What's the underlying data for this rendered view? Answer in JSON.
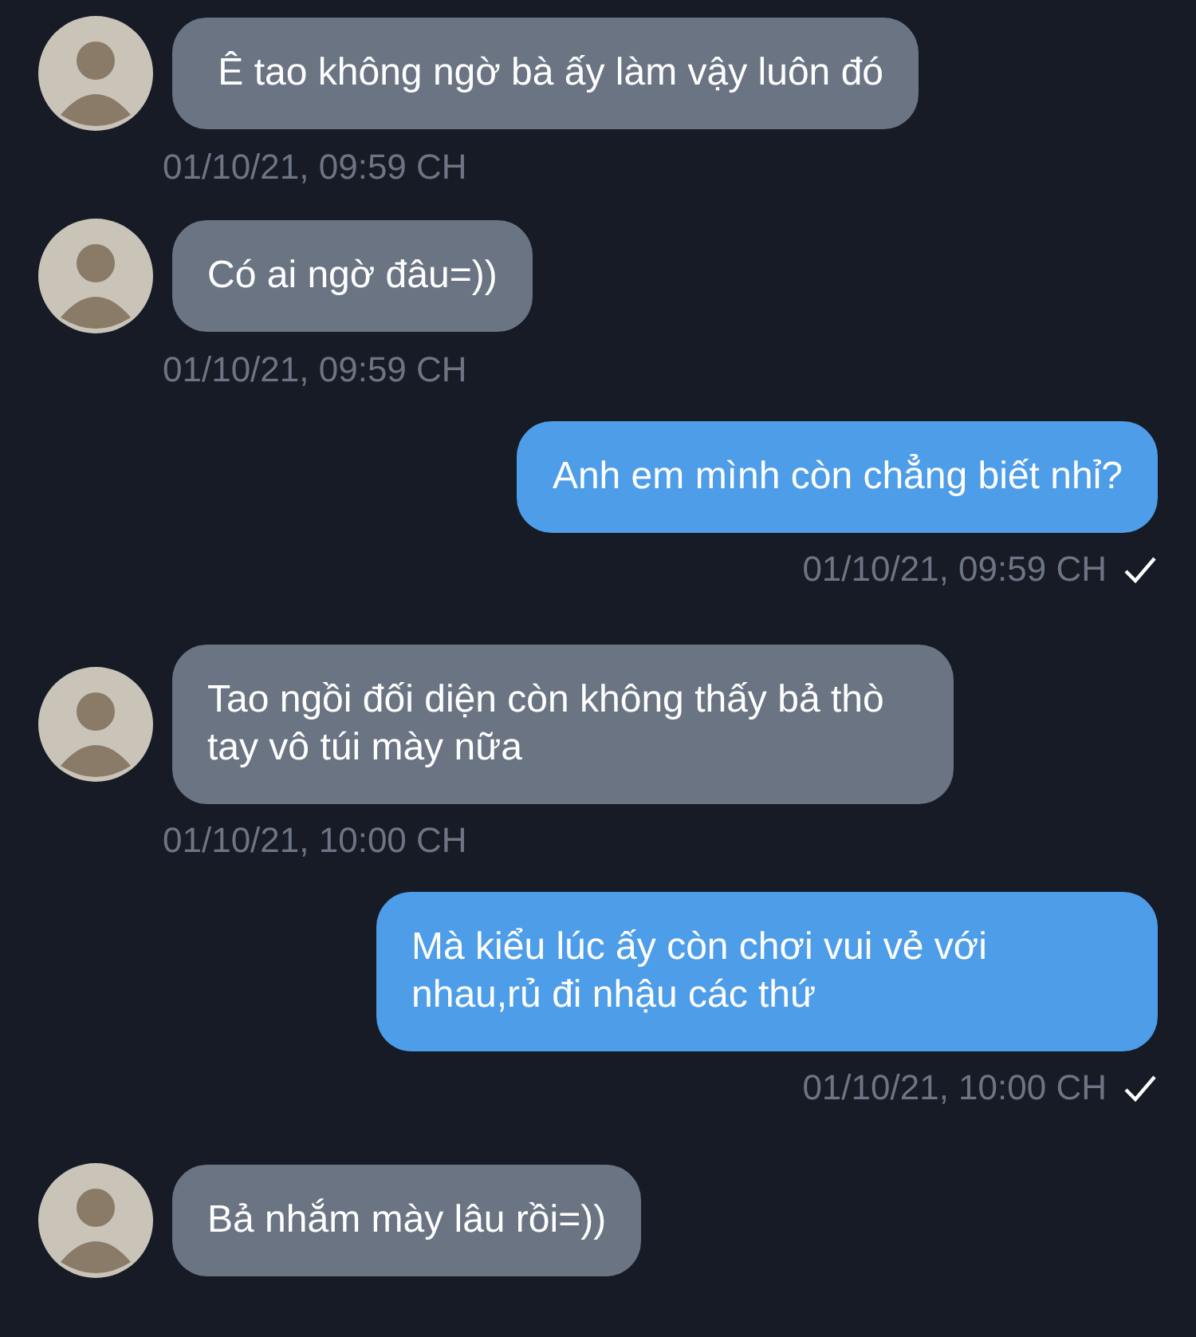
{
  "messages": [
    {
      "kind": "incoming",
      "text": " Ê tao không ngờ bà ấy làm vậy luôn đó",
      "time": "01/10/21, 09:59 CH"
    },
    {
      "kind": "incoming",
      "text": "Có ai ngờ đâu=))",
      "time": "01/10/21, 09:59 CH"
    },
    {
      "kind": "outgoing",
      "text": "Anh em mình còn chẳng biết nhỉ?",
      "time": "01/10/21, 09:59 CH",
      "read": true
    },
    {
      "kind": "incoming",
      "text": "Tao ngồi đối diện còn không thấy bả thò tay vô túi mày nữa",
      "time": "01/10/21, 10:00 CH"
    },
    {
      "kind": "outgoing",
      "text": "Mà kiểu lúc ấy còn chơi vui vẻ với nhau,rủ đi nhậu các thứ",
      "time": "01/10/21, 10:00 CH",
      "read": true
    },
    {
      "kind": "incoming",
      "text": "Bả nhắm mày lâu rồi=))"
    }
  ]
}
